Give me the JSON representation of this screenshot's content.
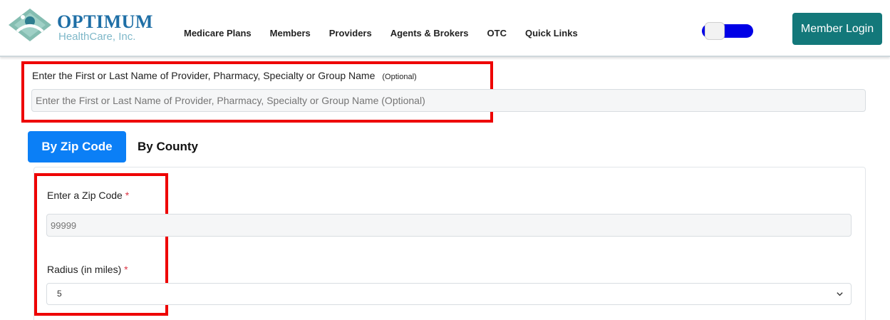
{
  "logo": {
    "name": "OPTIMUM",
    "tagline": "HealthCare, Inc."
  },
  "nav": {
    "items": [
      "Medicare Plans",
      "Members",
      "Providers",
      "Agents & Brokers",
      "OTC",
      "Quick Links"
    ]
  },
  "header": {
    "toggle_color": "#0000e6",
    "member_login_label": "Member Login",
    "member_login_color": "#13787a"
  },
  "search": {
    "label": "Enter the First or Last Name of Provider, Pharmacy, Specialty or Group Name",
    "optional_tag": "(Optional)",
    "placeholder": "Enter the First or Last Name of Provider, Pharmacy, Specialty or Group Name (Optional)"
  },
  "tabs": {
    "zip_label": "By Zip Code",
    "county_label": "By County",
    "active": "By Zip Code",
    "active_color": "#0b7ff6"
  },
  "form": {
    "zip_label": "Enter a Zip Code",
    "zip_required": "*",
    "zip_placeholder": "99999",
    "radius_label": "Radius (in miles)",
    "radius_required": "*",
    "radius_value": "5"
  },
  "highlight_color": "#ee0000"
}
